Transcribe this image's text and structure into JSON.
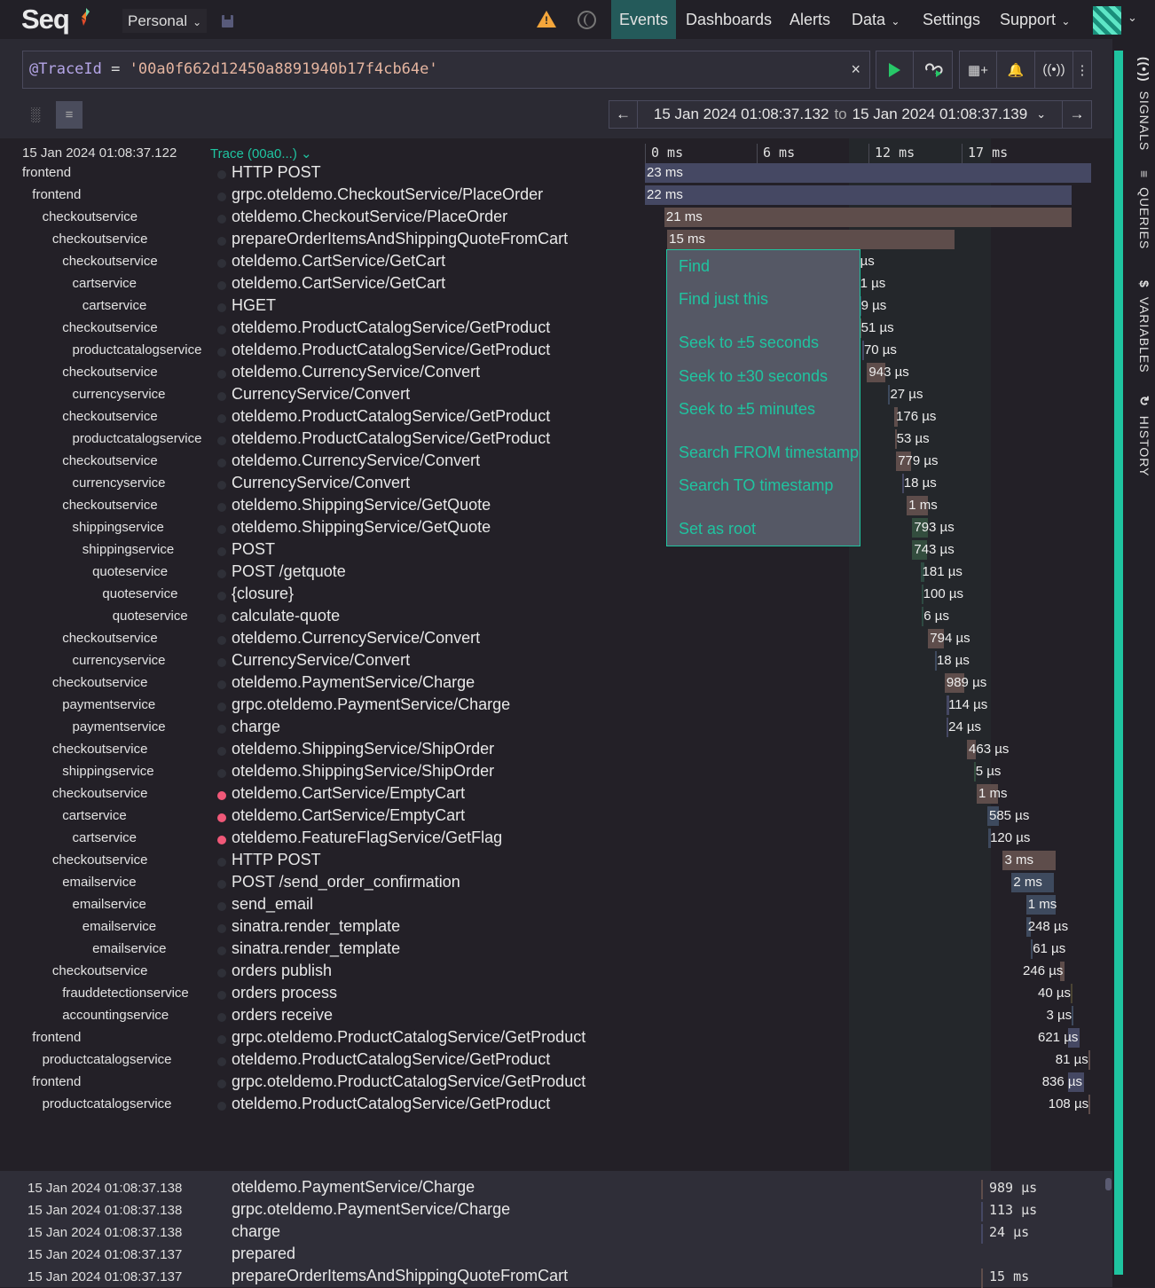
{
  "topbar": {
    "logo": "Seq",
    "workspace": "Personal",
    "nav": [
      {
        "label": "Events",
        "active": true
      },
      {
        "label": "Dashboards"
      },
      {
        "label": "Alerts"
      },
      {
        "label": "Data",
        "dropdown": true
      },
      {
        "label": "Settings"
      },
      {
        "label": "Support",
        "dropdown": true
      }
    ],
    "icons": [
      "warning-icon",
      "theme-toggle-icon",
      "save-icon",
      "avatar"
    ]
  },
  "query": {
    "property": "@TraceId",
    "operator": "=",
    "value": "'00a0f662d12450a8891940b17f4cb64e'",
    "clear_label": "×"
  },
  "toolbar": {
    "run": "run-query",
    "tail": "tail-results",
    "add_to_dashboard": "add-to-dashboard",
    "add_alert": "add-alert",
    "add_signal": "add-signal",
    "more": "more-options"
  },
  "range": {
    "from": "15 Jan 2024 01:08:37.132",
    "to_label": "to",
    "to": "15 Jan 2024 01:08:37.139",
    "prev": "←",
    "next": "→"
  },
  "trace": {
    "timestamp": "15 Jan 2024  01:08:37.122",
    "label": "Trace (00a0...)",
    "total_ms": 23,
    "ticks": [
      "0 ms",
      "6 ms",
      "12 ms",
      "17 ms"
    ],
    "spans": [
      {
        "service": "frontend",
        "depth": 0,
        "name": "HTTP POST",
        "start": 0,
        "dur": 23,
        "label": "23 ms",
        "color": "#454863",
        "error": false
      },
      {
        "service": "frontend",
        "depth": 1,
        "name": "grpc.oteldemo.CheckoutService/PlaceOrder",
        "start": 0,
        "dur": 22,
        "label": "22 ms",
        "color": "#454863",
        "error": false
      },
      {
        "service": "checkoutservice",
        "depth": 2,
        "name": "oteldemo.CheckoutService/PlaceOrder",
        "start": 1.0,
        "dur": 21,
        "label": "21 ms",
        "color": "#5e4d4b",
        "error": false
      },
      {
        "service": "checkoutservice",
        "depth": 3,
        "name": "prepareOrderItemsAndShippingQuoteFromCart",
        "start": 1.15,
        "dur": 14.8,
        "label": "15 ms",
        "color": "#5e4d4b",
        "error": false
      },
      {
        "service": "checkoutservice",
        "depth": 4,
        "name": "oteldemo.CartService/GetCart",
        "start": 11.0,
        "dur": 0.05,
        "label": "µs",
        "color": "#5e4d4b",
        "error": false
      },
      {
        "service": "cartservice",
        "depth": 5,
        "name": "oteldemo.CartService/GetCart",
        "start": 11.0,
        "dur": 0.02,
        "label": "1 µs",
        "color": "#3e4a5e",
        "error": false
      },
      {
        "service": "cartservice",
        "depth": 6,
        "name": "HGET",
        "start": 11.05,
        "dur": 0.009,
        "label": "9 µs",
        "color": "#3e4a5e",
        "error": false
      },
      {
        "service": "checkoutservice",
        "depth": 4,
        "name": "oteldemo.ProductCatalogService/GetProduct",
        "start": 11.05,
        "dur": 0.051,
        "label": "51 µs",
        "color": "#5e4d4b",
        "error": false
      },
      {
        "service": "productcatalogservice",
        "depth": 5,
        "name": "oteldemo.ProductCatalogService/GetProduct",
        "start": 11.2,
        "dur": 0.07,
        "label": "70 µs",
        "color": "#454863",
        "error": false
      },
      {
        "service": "checkoutservice",
        "depth": 4,
        "name": "oteldemo.CurrencyService/Convert",
        "start": 11.45,
        "dur": 0.943,
        "label": "943 µs",
        "color": "#5e4d4b",
        "error": false
      },
      {
        "service": "currencyservice",
        "depth": 5,
        "name": "CurrencyService/Convert",
        "start": 12.55,
        "dur": 0.027,
        "label": "27 µs",
        "color": "#3e4a5e",
        "error": false
      },
      {
        "service": "checkoutservice",
        "depth": 4,
        "name": "oteldemo.ProductCatalogService/GetProduct",
        "start": 12.85,
        "dur": 0.176,
        "label": "176 µs",
        "color": "#5e4d4b",
        "error": false
      },
      {
        "service": "productcatalogservice",
        "depth": 5,
        "name": "oteldemo.ProductCatalogService/GetProduct",
        "start": 12.88,
        "dur": 0.053,
        "label": "53 µs",
        "color": "#5e4d4b",
        "error": false
      },
      {
        "service": "checkoutservice",
        "depth": 4,
        "name": "oteldemo.CurrencyService/Convert",
        "start": 12.95,
        "dur": 0.779,
        "label": "779 µs",
        "color": "#5e4d4b",
        "error": false
      },
      {
        "service": "currencyservice",
        "depth": 5,
        "name": "CurrencyService/Convert",
        "start": 13.25,
        "dur": 0.018,
        "label": "18 µs",
        "color": "#454863",
        "error": false
      },
      {
        "service": "checkoutservice",
        "depth": 4,
        "name": "oteldemo.ShippingService/GetQuote",
        "start": 13.5,
        "dur": 1.1,
        "label": "1 ms",
        "color": "#5e4d4b",
        "error": false
      },
      {
        "service": "shippingservice",
        "depth": 5,
        "name": "oteldemo.ShippingService/GetQuote",
        "start": 13.78,
        "dur": 0.793,
        "label": "793 µs",
        "color": "#334d3e",
        "error": false
      },
      {
        "service": "shippingservice",
        "depth": 6,
        "name": "POST",
        "start": 13.78,
        "dur": 0.743,
        "label": "743 µs",
        "color": "#334d3e",
        "error": false
      },
      {
        "service": "quoteservice",
        "depth": 7,
        "name": "POST /getquote",
        "start": 14.2,
        "dur": 0.181,
        "label": "181 µs",
        "color": "#2e4a42",
        "error": false
      },
      {
        "service": "quoteservice",
        "depth": 8,
        "name": "{closure}",
        "start": 14.25,
        "dur": 0.1,
        "label": "100 µs",
        "color": "#2e4a42",
        "error": false
      },
      {
        "service": "quoteservice",
        "depth": 9,
        "name": "calculate-quote",
        "start": 14.28,
        "dur": 0.006,
        "label": "6 µs",
        "color": "#2e4a42",
        "error": false
      },
      {
        "service": "checkoutservice",
        "depth": 4,
        "name": "oteldemo.CurrencyService/Convert",
        "start": 14.6,
        "dur": 0.794,
        "label": "794 µs",
        "color": "#5e4d4b",
        "error": false
      },
      {
        "service": "currencyservice",
        "depth": 5,
        "name": "CurrencyService/Convert",
        "start": 14.95,
        "dur": 0.018,
        "label": "18 µs",
        "color": "#3e4a5e",
        "error": false
      },
      {
        "service": "checkoutservice",
        "depth": 3,
        "name": "oteldemo.PaymentService/Charge",
        "start": 15.45,
        "dur": 0.989,
        "label": "989 µs",
        "color": "#5e4d4b",
        "error": false
      },
      {
        "service": "paymentservice",
        "depth": 4,
        "name": "grpc.oteldemo.PaymentService/Charge",
        "start": 15.55,
        "dur": 0.114,
        "label": "114 µs",
        "color": "#454863",
        "error": false
      },
      {
        "service": "paymentservice",
        "depth": 5,
        "name": "charge",
        "start": 15.55,
        "dur": 0.024,
        "label": "24 µs",
        "color": "#454863",
        "error": false
      },
      {
        "service": "checkoutservice",
        "depth": 3,
        "name": "oteldemo.ShippingService/ShipOrder",
        "start": 16.6,
        "dur": 0.463,
        "label": "463 µs",
        "color": "#5e4d4b",
        "error": false
      },
      {
        "service": "shippingservice",
        "depth": 4,
        "name": "oteldemo.ShippingService/ShipOrder",
        "start": 16.95,
        "dur": 0.005,
        "label": "5 µs",
        "color": "#334d3e",
        "error": false
      },
      {
        "service": "checkoutservice",
        "depth": 3,
        "name": "oteldemo.CartService/EmptyCart",
        "start": 17.1,
        "dur": 1.1,
        "label": "1 ms",
        "color": "#5e4d4b",
        "error": true
      },
      {
        "service": "cartservice",
        "depth": 4,
        "name": "oteldemo.CartService/EmptyCart",
        "start": 17.65,
        "dur": 0.585,
        "label": "585 µs",
        "color": "#3e4a5e",
        "error": true
      },
      {
        "service": "cartservice",
        "depth": 5,
        "name": "oteldemo.FeatureFlagService/GetFlag",
        "start": 17.7,
        "dur": 0.12,
        "label": "120 µs",
        "color": "#3e4a5e",
        "error": true
      },
      {
        "service": "checkoutservice",
        "depth": 3,
        "name": "HTTP POST",
        "start": 18.45,
        "dur": 2.7,
        "label": "3 ms",
        "color": "#5e4d4b",
        "error": false
      },
      {
        "service": "emailservice",
        "depth": 4,
        "name": "POST /send_order_confirmation",
        "start": 18.9,
        "dur": 2.2,
        "label": "2 ms",
        "color": "#3e4a5e",
        "error": false
      },
      {
        "service": "emailservice",
        "depth": 5,
        "name": "send_email",
        "start": 19.65,
        "dur": 1.5,
        "label": "1 ms",
        "color": "#3e4a5e",
        "error": false
      },
      {
        "service": "emailservice",
        "depth": 6,
        "name": "sinatra.render_template",
        "start": 19.65,
        "dur": 0.248,
        "label": "248 µs",
        "color": "#3e4a5e",
        "error": false
      },
      {
        "service": "emailservice",
        "depth": 7,
        "name": "sinatra.render_template",
        "start": 19.9,
        "dur": 0.061,
        "label": "61 µs",
        "color": "#3e4a5e",
        "error": false
      },
      {
        "service": "checkoutservice",
        "depth": 3,
        "name": "orders publish",
        "start": 21.4,
        "dur": 0.246,
        "label": "246 µs",
        "color": "#5e4d4b",
        "error": false
      },
      {
        "service": "frauddetectionservice",
        "depth": 4,
        "name": "orders process",
        "start": 21.95,
        "dur": 0.04,
        "label": "40 µs",
        "color": "#4a4433",
        "error": false
      },
      {
        "service": "accountingservice",
        "depth": 4,
        "name": "orders receive",
        "start": 22.0,
        "dur": 0.003,
        "label": "3 µs",
        "color": "#3e4a5e",
        "error": false
      },
      {
        "service": "frontend",
        "depth": 1,
        "name": "grpc.oteldemo.ProductCatalogService/GetProduct",
        "start": 21.8,
        "dur": 0.621,
        "label": "621 µs",
        "color": "#454863",
        "error": false
      },
      {
        "service": "productcatalogservice",
        "depth": 2,
        "name": "oteldemo.ProductCatalogService/GetProduct",
        "start": 22.85,
        "dur": 0.081,
        "label": "81 µs",
        "color": "#5e4d4b",
        "error": false
      },
      {
        "service": "frontend",
        "depth": 1,
        "name": "grpc.oteldemo.ProductCatalogService/GetProduct",
        "start": 21.8,
        "dur": 0.836,
        "label": "836 µs",
        "color": "#454863",
        "error": false
      },
      {
        "service": "productcatalogservice",
        "depth": 2,
        "name": "oteldemo.ProductCatalogService/GetProduct",
        "start": 22.85,
        "dur": 0.108,
        "label": "108 µs",
        "color": "#5e4d4b",
        "error": false
      }
    ]
  },
  "context_menu": {
    "items": [
      {
        "label": "Find"
      },
      {
        "label": "Find just this"
      },
      {
        "label": "Seek to ±5 seconds"
      },
      {
        "label": "Seek to ±30 seconds"
      },
      {
        "label": "Seek to ±5 minutes"
      },
      {
        "label": "Search FROM timestamp"
      },
      {
        "label": "Search TO timestamp"
      },
      {
        "label": "Set as root"
      }
    ]
  },
  "results": [
    {
      "time": "15 Jan 2024  01:08:37.138",
      "message": "oteldemo.PaymentService/Charge",
      "duration": "989 µs",
      "bar_color": "#5e4d4b"
    },
    {
      "time": "15 Jan 2024  01:08:37.138",
      "message": "grpc.oteldemo.PaymentService/Charge",
      "duration": "113 µs",
      "bar_color": "#454863"
    },
    {
      "time": "15 Jan 2024  01:08:37.138",
      "message": "charge",
      "duration": "24 µs",
      "bar_color": "#454863"
    },
    {
      "time": "15 Jan 2024  01:08:37.137",
      "message": "prepared",
      "duration": "",
      "bar_color": ""
    },
    {
      "time": "15 Jan 2024  01:08:37.137",
      "message": "prepareOrderItemsAndShippingQuoteFromCart",
      "duration": "15 ms",
      "bar_color": "#5e4d4b"
    }
  ],
  "sidebar": {
    "items": [
      {
        "label": "SIGNALS",
        "icon": "signals-icon"
      },
      {
        "label": "QUERIES",
        "icon": "queries-icon"
      },
      {
        "label": "VARIABLES",
        "icon": "variables-icon"
      },
      {
        "label": "HISTORY",
        "icon": "history-icon"
      }
    ]
  }
}
